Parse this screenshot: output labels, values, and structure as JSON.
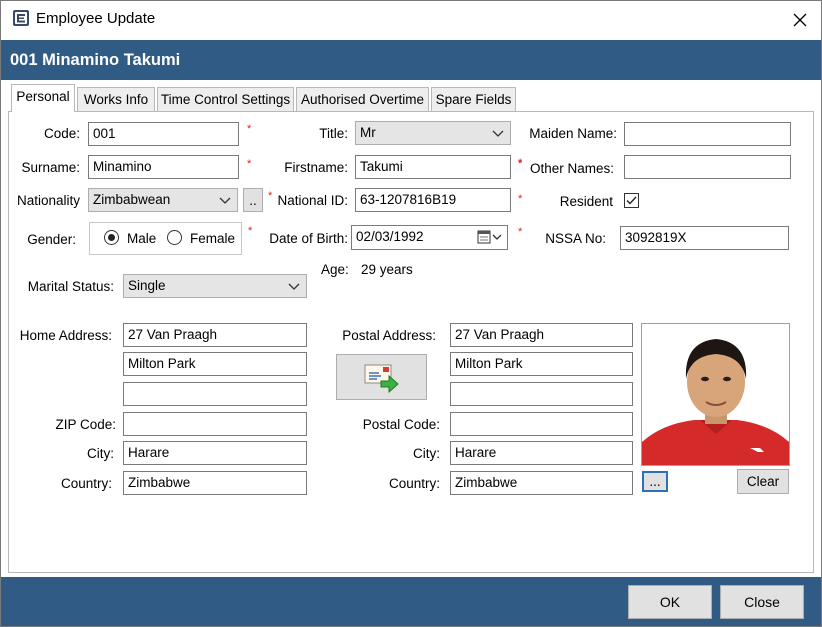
{
  "window": {
    "title": "Employee Update",
    "close_glyph": "✕"
  },
  "header": {
    "employee_title": "001 Minamino Takumi"
  },
  "tabs": [
    {
      "label": "Personal",
      "active": true
    },
    {
      "label": "Works Info",
      "active": false
    },
    {
      "label": "Time Control Settings",
      "active": false
    },
    {
      "label": "Authorised Overtime",
      "active": false
    },
    {
      "label": "Spare Fields",
      "active": false
    }
  ],
  "form": {
    "code": {
      "label": "Code:",
      "value": "001",
      "required": "*"
    },
    "surname": {
      "label": "Surname:",
      "value": "Minamino",
      "required": "*"
    },
    "nationality": {
      "label": "Nationality",
      "value": "Zimbabwean",
      "browse_label": ".."
    },
    "gender": {
      "label": "Gender:",
      "male_label": "Male",
      "female_label": "Female",
      "selected": "Male",
      "required": "*"
    },
    "marital_status": {
      "label": "Marital Status:",
      "value": "Single"
    },
    "title": {
      "label": "Title:",
      "value": "Mr",
      "required": "*"
    },
    "firstname": {
      "label": "Firstname:",
      "value": "Takumi",
      "required": "*"
    },
    "national_id": {
      "label": "National ID:",
      "value": "63-1207816B19",
      "required": "*"
    },
    "date_of_birth": {
      "label": "Date of Birth:",
      "value": "02/03/1992",
      "required": "*"
    },
    "age": {
      "label": "Age:",
      "value": "29 years"
    },
    "maiden_name": {
      "label": "Maiden Name:",
      "value": ""
    },
    "other_names": {
      "label": "Other Names:",
      "value": "",
      "required": "*"
    },
    "resident": {
      "label": "Resident",
      "checked": true,
      "required": "*"
    },
    "nssa_no": {
      "label": "NSSA No:",
      "value": "3092819X",
      "required": "*"
    }
  },
  "home_address": {
    "label": "Home Address:",
    "line1": "27 Van Praagh",
    "line2": "Milton Park",
    "line3": "",
    "zip_label": "ZIP Code:",
    "zip": "",
    "city_label": "City:",
    "city": "Harare",
    "country_label": "Country:",
    "country": "Zimbabwe"
  },
  "postal_address": {
    "label": "Postal Address:",
    "line1": "27 Van Praagh",
    "line2": "Milton Park",
    "line3": "",
    "postal_label": "Postal Code:",
    "postal": "",
    "city_label": "City:",
    "city": "Harare",
    "country_label": "Country:",
    "country": "Zimbabwe"
  },
  "photo": {
    "browse_label": "...",
    "clear_label": "Clear"
  },
  "footer": {
    "ok_label": "OK",
    "close_label": "Close"
  },
  "colors": {
    "header": "#2f5b84",
    "required": "#e02020"
  }
}
